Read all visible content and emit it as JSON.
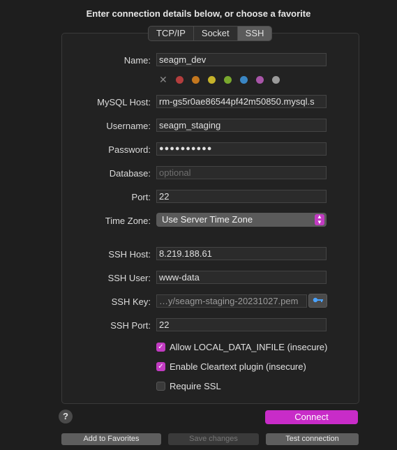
{
  "heading": "Enter connection details below, or choose a favorite",
  "tabs": [
    "TCP/IP",
    "Socket",
    "SSH"
  ],
  "active_tab": "SSH",
  "form": {
    "name_label": "Name:",
    "name_value": "seagm_dev",
    "colors": [
      "#b33d3d",
      "#c4771e",
      "#c5b22a",
      "#79a82e",
      "#3a86c4",
      "#a855a8",
      "#9a9a9a"
    ],
    "mysql_host_label": "MySQL Host:",
    "mysql_host_value": "rm-gs5r0ae86544pf42m50850.mysql.s",
    "username_label": "Username:",
    "username_value": "seagm_staging",
    "password_label": "Password:",
    "password_value": "●●●●●●●●●●",
    "database_label": "Database:",
    "database_placeholder": "optional",
    "port_label": "Port:",
    "port_value": "22",
    "timezone_label": "Time Zone:",
    "timezone_value": "Use Server Time Zone",
    "ssh_host_label": "SSH Host:",
    "ssh_host_value": "8.219.188.61",
    "ssh_user_label": "SSH User:",
    "ssh_user_value": "www-data",
    "ssh_key_label": "SSH Key:",
    "ssh_key_value": "…y/seagm-staging-20231027.pem",
    "ssh_port_label": "SSH Port:",
    "ssh_port_value": "22"
  },
  "checkboxes": [
    {
      "label": "Allow LOCAL_DATA_INFILE (insecure)",
      "checked": true
    },
    {
      "label": "Enable Cleartext plugin (insecure)",
      "checked": true
    },
    {
      "label": "Require SSL",
      "checked": false
    }
  ],
  "buttons": {
    "help": "?",
    "connect": "Connect",
    "add_favorites": "Add to Favorites",
    "save_changes": "Save changes",
    "test_connection": "Test connection"
  },
  "icons": {
    "clear": "x-icon",
    "key": "key-icon",
    "stepper": "chevron-up-down-icon"
  }
}
